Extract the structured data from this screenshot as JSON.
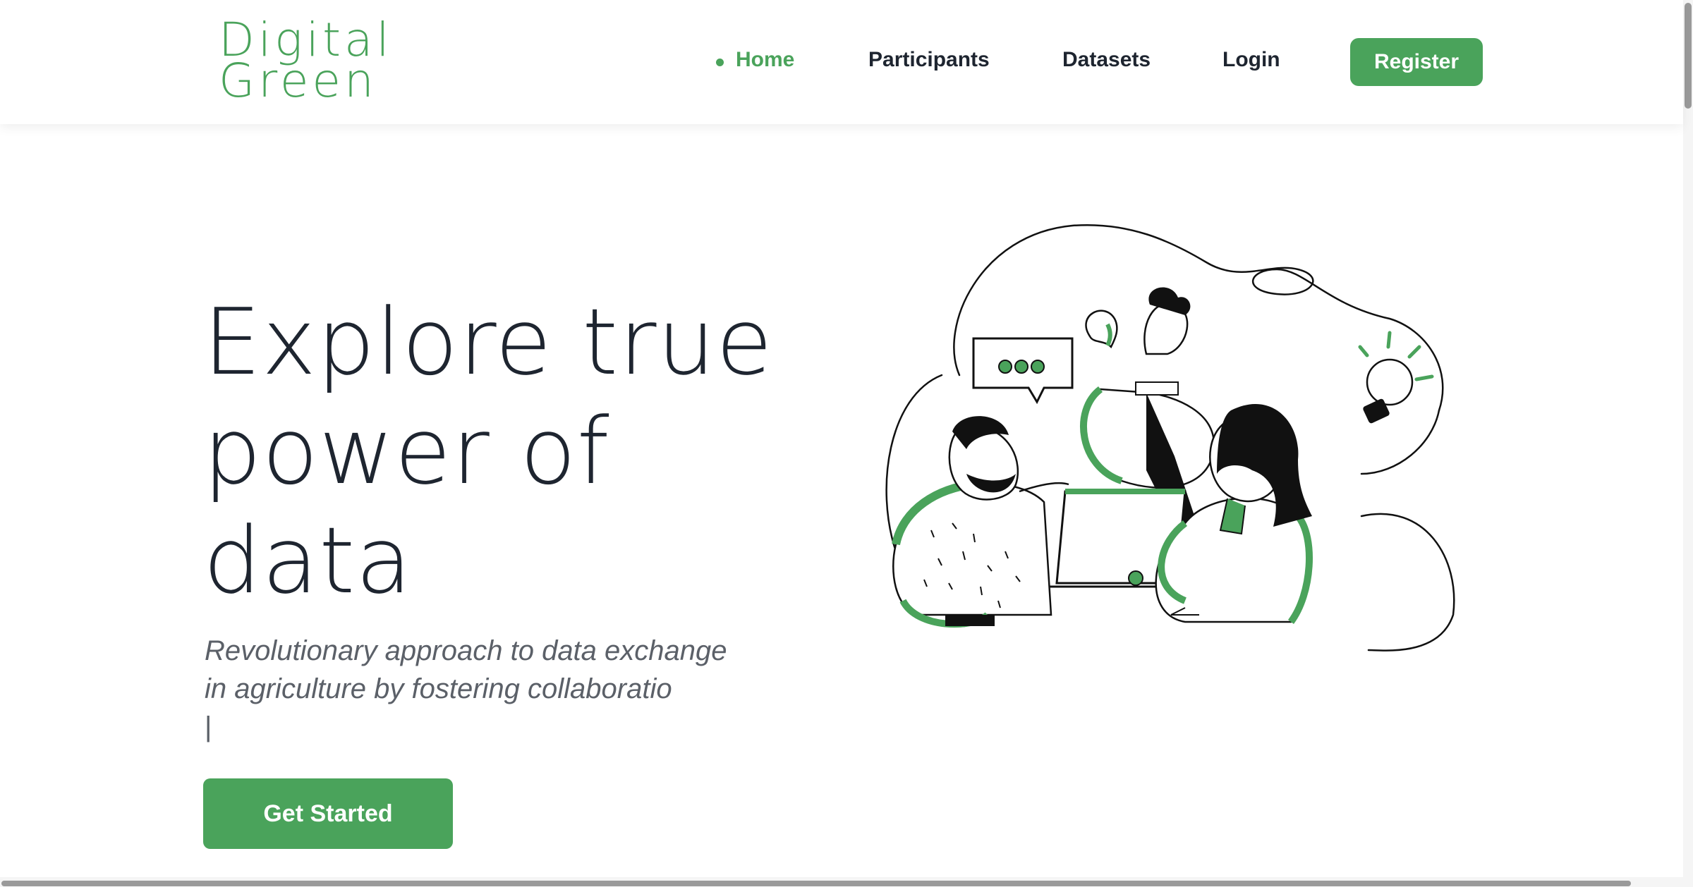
{
  "brand": {
    "line1": "Digital",
    "line2": "Green"
  },
  "nav": {
    "items": [
      {
        "label": "Home",
        "active": true
      },
      {
        "label": "Participants",
        "active": false
      },
      {
        "label": "Datasets",
        "active": false
      },
      {
        "label": "Login",
        "active": false
      }
    ],
    "register_label": "Register"
  },
  "hero": {
    "title_lines": [
      "Explore true",
      "power of",
      "data"
    ],
    "subtitle_lines": [
      "Revolutionary approach to data exchange",
      "in agriculture by fostering collaboratio"
    ],
    "caret": "|",
    "cta_label": "Get Started"
  },
  "colors": {
    "accent": "#4aa35b",
    "text_dark": "#1e2530",
    "text_muted": "#5b6068"
  },
  "illustration": {
    "icon": "team-collaboration-illustration"
  }
}
